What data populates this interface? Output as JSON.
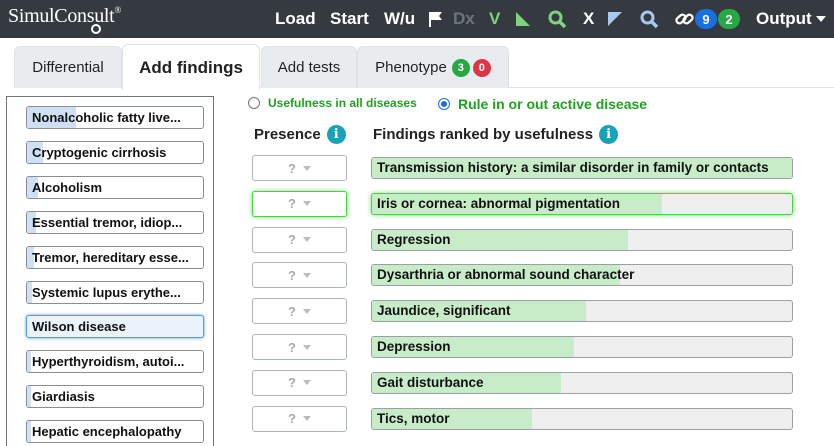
{
  "app": {
    "logo": "SimulConsult",
    "logo_mark": "®"
  },
  "topnav": {
    "load": "Load",
    "start": "Start",
    "wu": "W/u",
    "dx": "Dx",
    "v": "V",
    "x": "X",
    "badge_blue": "9",
    "badge_green": "2",
    "output": "Output"
  },
  "tabs": {
    "differential": "Differential",
    "add_findings": "Add findings",
    "add_tests": "Add tests",
    "phenotype": "Phenotype",
    "phenotype_badge_green": "3",
    "phenotype_badge_red": "0"
  },
  "differential_list": [
    {
      "label": "Nonalcoholic fatty live...",
      "likelihood": 0.28
    },
    {
      "label": "Cryptogenic cirrhosis",
      "likelihood": 0.09
    },
    {
      "label": "Alcoholism",
      "likelihood": 0.06
    },
    {
      "label": "Essential tremor, idiop...",
      "likelihood": 0.05
    },
    {
      "label": "Tremor, hereditary esse...",
      "likelihood": 0.04
    },
    {
      "label": "Systemic lupus erythe...",
      "likelihood": 0.03
    },
    {
      "label": "Wilson disease",
      "likelihood": 0.03,
      "selected": true
    },
    {
      "label": "Hyperthyroidism, autoi...",
      "likelihood": 0.02
    },
    {
      "label": "Giardiasis",
      "likelihood": 0.02
    },
    {
      "label": "Hepatic encephalopathy",
      "likelihood": 0.02
    }
  ],
  "mode": {
    "option_all": "Usefulness in all diseases",
    "option_active": "Rule in or out active disease",
    "selected": "option_active"
  },
  "columns": {
    "presence": "Presence",
    "findings": "Findings ranked by usefulness"
  },
  "presence_placeholder": "?",
  "findings": [
    {
      "label": "Transmission history: a similar disorder in family or contacts",
      "usefulness": 1.0
    },
    {
      "label": "Iris or cornea: abnormal pigmentation",
      "usefulness": 0.69,
      "highlighted": true
    },
    {
      "label": "Regression",
      "usefulness": 0.61
    },
    {
      "label": "Dysarthria or abnormal sound character",
      "usefulness": 0.59
    },
    {
      "label": "Jaundice, significant",
      "usefulness": 0.51
    },
    {
      "label": "Depression",
      "usefulness": 0.48
    },
    {
      "label": "Gait disturbance",
      "usefulness": 0.45
    },
    {
      "label": "Tics, motor",
      "usefulness": 0.38
    }
  ],
  "colors": {
    "accent_green": "#1fa31f",
    "info_teal": "#17a2b8",
    "bar_green": "#c8ecc8",
    "bar_blue": "#cfe0f5"
  }
}
